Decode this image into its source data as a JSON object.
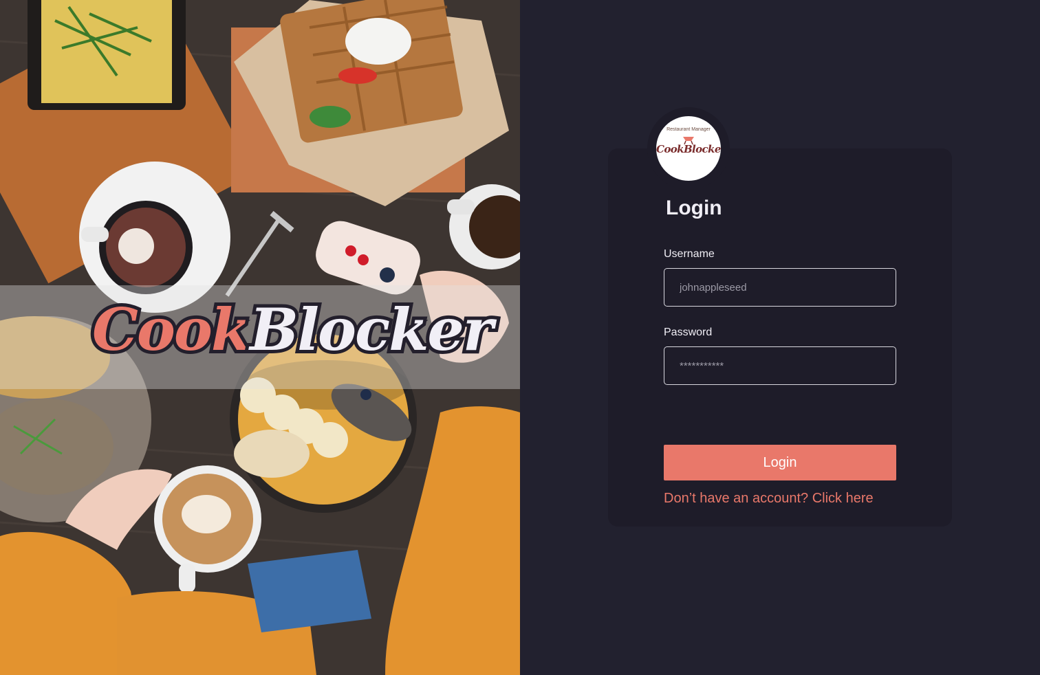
{
  "hero": {
    "brand_part1": "Cook",
    "brand_part2": "Blocker"
  },
  "logo": {
    "tagline": "Restaurant Manager",
    "wordmark": "CookBlocker"
  },
  "login": {
    "title": "Login",
    "username_label": "Username",
    "username_placeholder": "johnappleseed",
    "password_label": "Password",
    "password_placeholder": "***********",
    "submit_label": "Login",
    "signup_text": "Don’t have an account? Click here"
  },
  "colors": {
    "background": "#22212f",
    "card": "#1e1c29",
    "accent": "#e9786a",
    "text": "#f0eef5"
  }
}
